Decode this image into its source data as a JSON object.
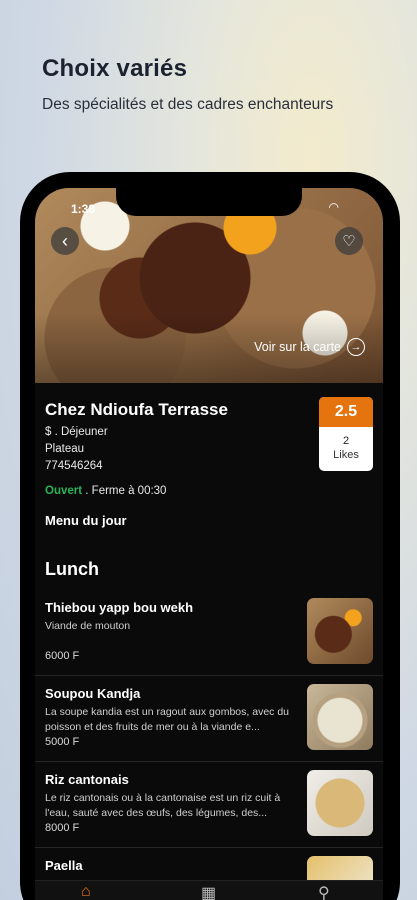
{
  "promo": {
    "title": "Choix variés",
    "subtitle": "Des spécialités et des cadres enchanteurs"
  },
  "status_bar": {
    "time": "1:38"
  },
  "hero": {
    "map_link": "Voir sur la carte"
  },
  "restaurant": {
    "name": "Chez Ndioufa Terrasse",
    "category": "$ . Déjeuner",
    "area": "Plateau",
    "phone": "774546264",
    "open_status": "Ouvert",
    "closing": " . Ferme à 00:30",
    "rating": "2.5",
    "likes_count": "2",
    "likes_label": "Likes"
  },
  "menu": {
    "title": "Menu du jour",
    "section": "Lunch",
    "items": [
      {
        "name": "Thiebou yapp bou wekh",
        "desc": "Viande de mouton",
        "price": "6000 F"
      },
      {
        "name": "Soupou Kandja",
        "desc": "La soupe kandia est un ragout aux gombos, avec du poisson et des fruits de mer ou à la viande e...",
        "price": "5000 F"
      },
      {
        "name": "Riz cantonais",
        "desc": "Le riz cantonais ou à la cantonaise est un riz cuit à l'eau, sauté avec des œufs, des légumes, des...",
        "price": "8000 F"
      },
      {
        "name": "Paella",
        "desc": "",
        "price": ""
      }
    ]
  },
  "colors": {
    "accent": "#e5740f",
    "open": "#2bb35a"
  }
}
